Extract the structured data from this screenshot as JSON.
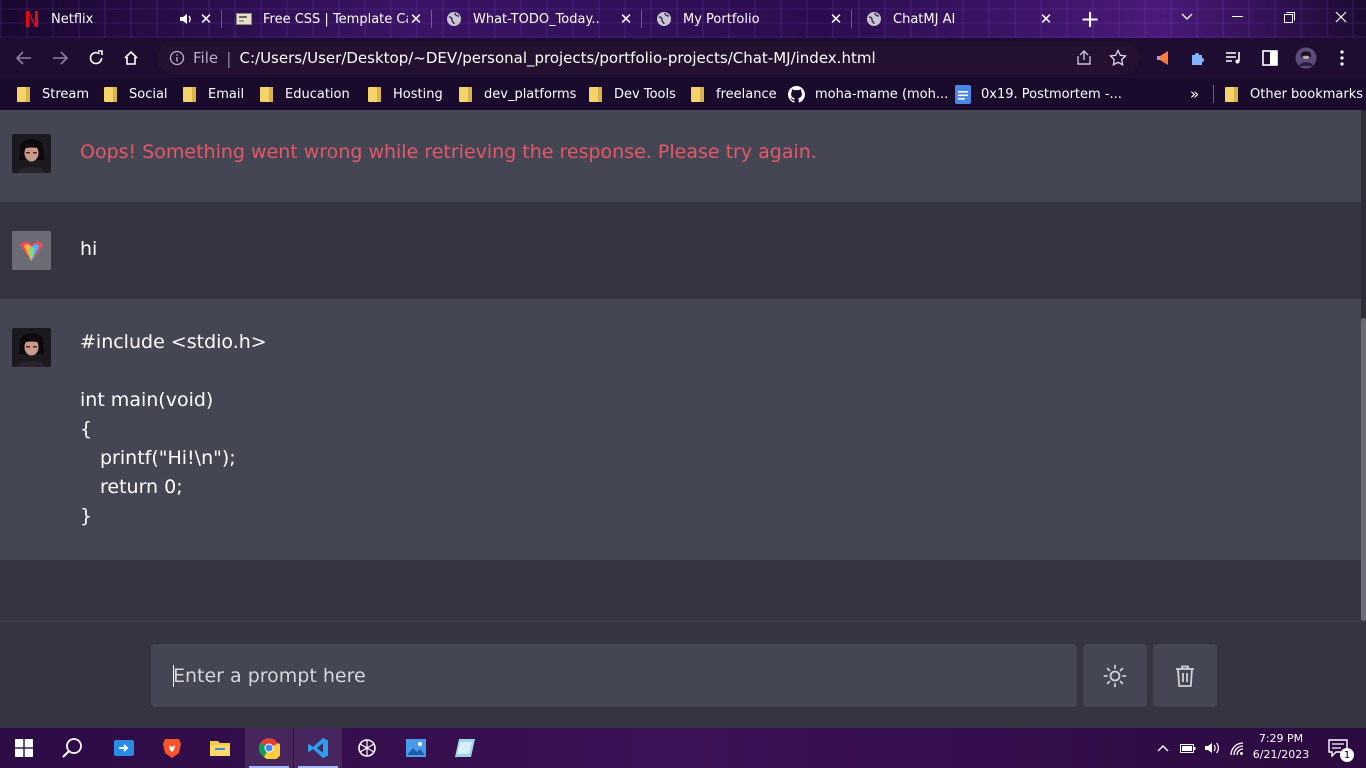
{
  "browser": {
    "tabs": [
      {
        "title": "Netflix",
        "icon": "netflix-icon",
        "audio": true
      },
      {
        "title": "Free CSS | Template Cat",
        "icon": "template-icon"
      },
      {
        "title": "What-TODO_Today..",
        "icon": "globe-icon"
      },
      {
        "title": "My Portfolio",
        "icon": "globe-icon"
      },
      {
        "title": "ChatMJ AI",
        "icon": "globe-icon",
        "active": true
      }
    ],
    "new_tab_label": "+",
    "address": {
      "scheme_label": "File",
      "separator": "|",
      "url": "C:/Users/User/Desktop/~DEV/personal_projects/portfolio-projects/Chat-MJ/index.html"
    },
    "bookmarks": [
      {
        "label": "Stream",
        "icon": "folder-icon"
      },
      {
        "label": "Social",
        "icon": "folder-icon"
      },
      {
        "label": "Email",
        "icon": "folder-icon"
      },
      {
        "label": "Education",
        "icon": "folder-icon"
      },
      {
        "label": "Hosting",
        "icon": "folder-icon"
      },
      {
        "label": "dev_platforms",
        "icon": "folder-icon"
      },
      {
        "label": "Dev Tools",
        "icon": "folder-icon"
      },
      {
        "label": "freelance",
        "icon": "folder-icon"
      },
      {
        "label": "moha-mame (moh...",
        "icon": "github-icon"
      },
      {
        "label": "0x19. Postmortem -...",
        "icon": "docs-icon"
      }
    ],
    "bookmarks_more": "»",
    "other_bookmarks": "Other bookmarks"
  },
  "chat": {
    "messages": [
      {
        "role": "bot",
        "text": "Oops! Something went wrong while retrieving the response. Please try again.",
        "error": true
      },
      {
        "role": "user",
        "text": "hi"
      },
      {
        "role": "bot",
        "code_lines": [
          "#include <stdio.h>",
          "",
          "int main(void)",
          "{",
          "printf(\"Hi!\\n\");",
          "return 0;",
          "}"
        ]
      }
    ]
  },
  "input": {
    "placeholder": "Enter a prompt here",
    "theme_button_icon": "sun-icon",
    "delete_button_icon": "trash-icon"
  },
  "taskbar": {
    "time": "7:29 PM",
    "date": "6/21/2023",
    "notification_count": "1"
  },
  "colors": {
    "chat_bg": "#343541",
    "bot_bg": "#444654",
    "error_text": "#e55865",
    "text": "#ffffff"
  }
}
